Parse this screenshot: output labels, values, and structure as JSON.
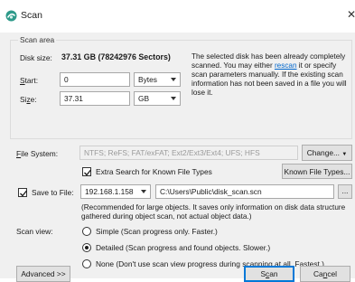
{
  "window": {
    "title": "Scan"
  },
  "scan_area": {
    "legend": "Scan area",
    "disk_size_label": "Disk size:",
    "disk_size_value": "37.31 GB (78242976 Sectors)",
    "start_label": "Start:",
    "start_value": "0",
    "start_unit": "Bytes",
    "size_label": "Size:",
    "size_value": "37.31",
    "size_unit": "GB",
    "note_pre": "The selected disk has been already completely scanned. You may either ",
    "note_link": "rescan",
    "note_post": " it or specify scan parameters manually. If the existing scan information has not been saved in a file you will lose it."
  },
  "file_system": {
    "label": "File System:",
    "value": "NTFS; ReFS; FAT/exFAT; Ext2/Ext3/Ext4; UFS; HFS",
    "change_button": "Change..."
  },
  "extra_search": {
    "label": "Extra Search for Known File Types",
    "checked": true,
    "known_types_button": "Known File Types..."
  },
  "save_to_file": {
    "label": "Save to File:",
    "checked": true,
    "host": "192.168.1.158",
    "path": "C:\\Users\\Public\\disk_scan.scn",
    "browse_button": "...",
    "note": "(Recommended for large objects. It saves only information on disk data structure gathered during object scan, not actual object data.)"
  },
  "scan_view": {
    "label": "Scan view:",
    "options": [
      {
        "label": "Simple (Scan progress only. Faster.)",
        "selected": false
      },
      {
        "label": "Detailed (Scan progress and found objects. Slower.)",
        "selected": true
      },
      {
        "label": "None (Don't use scan view progress during scanning at all. Fastest.)",
        "selected": false
      }
    ]
  },
  "footer": {
    "advanced_button": "Advanced >>",
    "scan_button": "Scan",
    "cancel_button": "Cancel"
  }
}
